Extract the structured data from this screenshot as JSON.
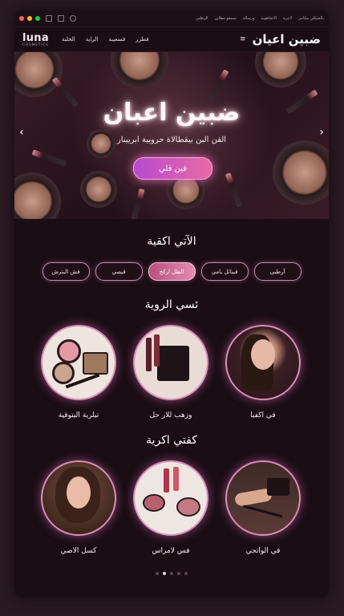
{
  "window": {
    "top_links": [
      "بالشكلي مكاتيز",
      "لاعرة",
      "الاتجاهوية",
      "ورسالة",
      "سمعو مطاين",
      "الرطني"
    ]
  },
  "nav": {
    "logo": "luna",
    "logo_sub": "COSMETICS",
    "links": [
      "فطزر",
      "فسعيبة",
      "الراية",
      "الخلبة"
    ],
    "brand": "ضبين اعيان"
  },
  "hero": {
    "title": "ضبين اعبان",
    "subtitle": "القن البن بيقطالاة حروبية ابريينار",
    "button": "فين قلي"
  },
  "categories": {
    "title": "الآتي اكقية",
    "pills": [
      "آرطبي",
      "فبنائل يامي",
      "الطل اركخ",
      "قيصي",
      "فش البترش"
    ],
    "active_index": 2
  },
  "section1": {
    "title": "ئسي الروية",
    "items": [
      {
        "caption": "في اكفيا",
        "image": "portrait-woman"
      },
      {
        "caption": "وزهب للار حل",
        "image": "makeup-palette"
      },
      {
        "caption": "تيلرية اليتوقية",
        "image": "brushes-compacts"
      }
    ]
  },
  "section2": {
    "title": "كفتي اكرية",
    "items": [
      {
        "caption": "في الواتجي",
        "image": "hand-applying"
      },
      {
        "caption": "فس لامراس",
        "image": "cosmetics-flatlay"
      },
      {
        "caption": "كسل الاصي",
        "image": "woman-portrait-2"
      }
    ]
  },
  "pagination": {
    "count": 5,
    "active": 1
  }
}
